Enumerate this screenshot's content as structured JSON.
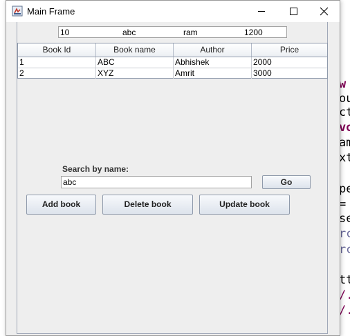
{
  "window": {
    "title": "Main Frame"
  },
  "topfield": {
    "parts": [
      "10",
      "abc",
      "ram",
      "1200"
    ]
  },
  "table": {
    "headers": [
      "Book Id",
      "Book name",
      "Author",
      "Price"
    ],
    "rows": [
      [
        "1",
        "ABC",
        "Abhishek",
        "2000"
      ],
      [
        "2",
        "XYZ",
        "Amrit",
        "3000"
      ]
    ]
  },
  "search": {
    "label": "Search by name:",
    "value": "abc",
    "go_label": "Go"
  },
  "actions": {
    "add_label": "Add book",
    "delete_label": "Delete book",
    "update_label": "Update book"
  },
  "background_code": {
    "lines": [
      "w",
      "ou",
      "ct",
      "vo",
      "am",
      "xt",
      "pe",
      "=",
      "se",
      "rc",
      "rc",
      "tt",
      "/.",
      "/."
    ]
  },
  "colors": {
    "accent": "#8f9aab",
    "keyword": "#7f0055"
  }
}
